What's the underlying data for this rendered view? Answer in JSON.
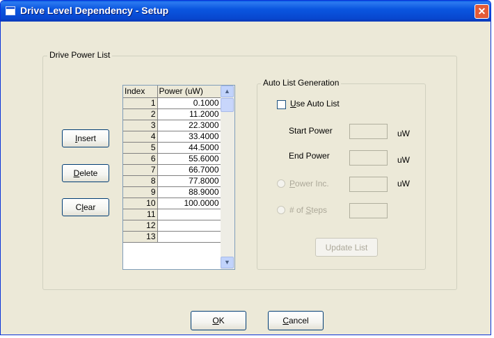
{
  "window": {
    "title": "Drive Level Dependency - Setup",
    "close_glyph": "✕"
  },
  "drive_power_list": {
    "legend": "Drive Power List",
    "buttons": {
      "insert": {
        "accel": "I",
        "rest": "nsert"
      },
      "delete": {
        "accel": "D",
        "rest": "elete"
      },
      "clear": {
        "first": "C",
        "accel": "l",
        "rest": "ear"
      }
    },
    "grid": {
      "columns": [
        "Index",
        "Power (uW)"
      ],
      "rows": [
        [
          "1",
          "0.1000"
        ],
        [
          "2",
          "11.2000"
        ],
        [
          "3",
          "22.3000"
        ],
        [
          "4",
          "33.4000"
        ],
        [
          "5",
          "44.5000"
        ],
        [
          "6",
          "55.6000"
        ],
        [
          "7",
          "66.7000"
        ],
        [
          "8",
          "77.8000"
        ],
        [
          "9",
          "88.9000"
        ],
        [
          "10",
          "100.0000"
        ],
        [
          "11",
          ""
        ],
        [
          "12",
          ""
        ],
        [
          "13",
          ""
        ]
      ],
      "scroll_up_glyph": "▲",
      "scroll_down_glyph": "▼"
    }
  },
  "auto_list": {
    "legend": "Auto List Generation",
    "use_auto_list": {
      "accel": "U",
      "rest": "se Auto List",
      "checked": false
    },
    "start_power": {
      "label": "Start Power",
      "unit": "uW",
      "value": ""
    },
    "end_power": {
      "label": "End Power",
      "unit": "uW",
      "value": ""
    },
    "power_inc": {
      "accel": "P",
      "rest": "ower Inc.",
      "unit": "uW",
      "value": ""
    },
    "num_steps": {
      "before": "# of ",
      "accel": "S",
      "rest": "teps",
      "value": ""
    },
    "update_list": "Update List"
  },
  "footer": {
    "ok": {
      "accel": "O",
      "rest": "K"
    },
    "cancel": {
      "accel": "C",
      "rest": "ancel"
    }
  }
}
